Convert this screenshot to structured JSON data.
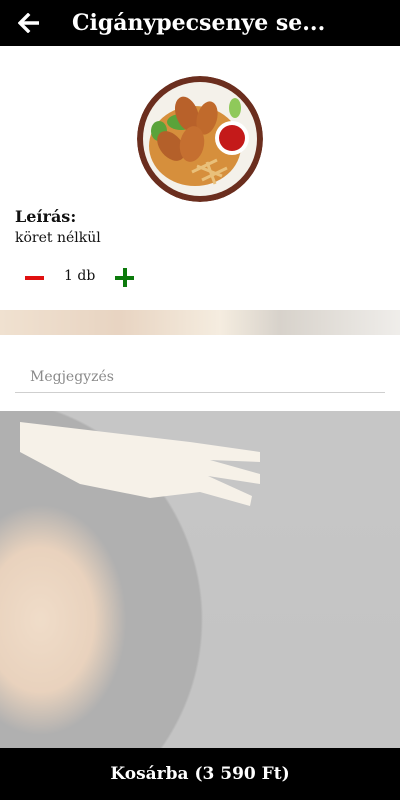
{
  "header": {
    "title": "Cigánypecsenye se...",
    "back_icon": "arrow-left-icon"
  },
  "product": {
    "image_icon": "food-plate-image",
    "description_label": "Leírás:",
    "description_text": "köret nélkül"
  },
  "quantity": {
    "minus_icon": "minus-icon",
    "value": "1 db",
    "plus_icon": "plus-icon",
    "minus_color": "#e01010",
    "plus_color": "#0c7a0c"
  },
  "note": {
    "placeholder": "Megjegyzés",
    "value": ""
  },
  "cart": {
    "label": "Kosárba (3 590 Ft)"
  }
}
